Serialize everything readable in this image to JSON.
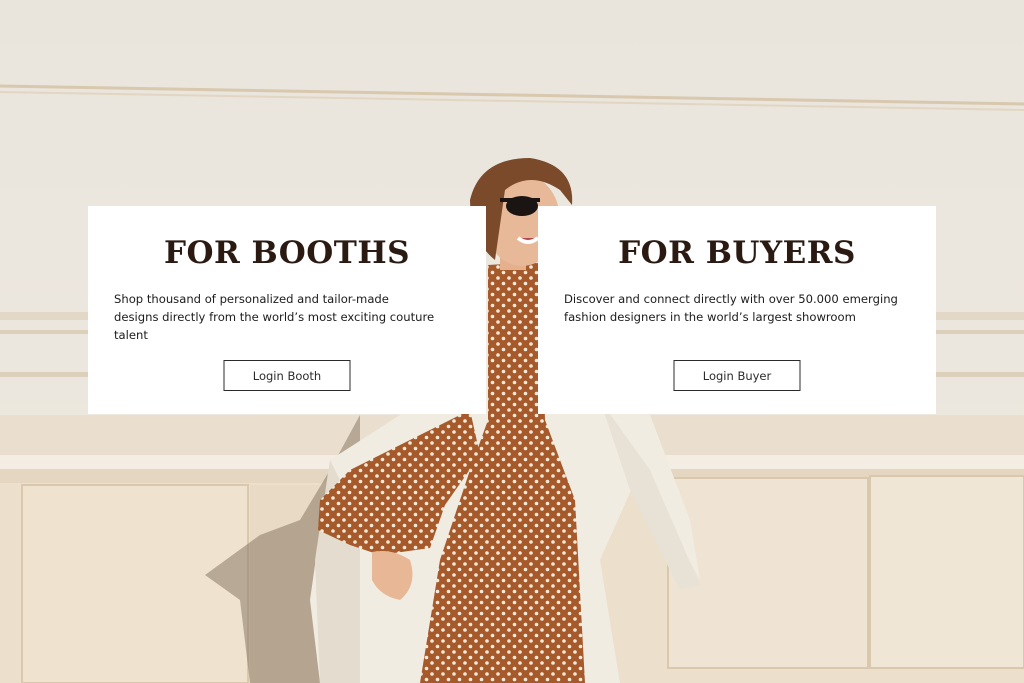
{
  "booths": {
    "title": "FOR BOOTHS",
    "description": "Shop thousand of personalized and tailor-made\ndesigns directly from the world’s most exciting couture talent",
    "button_label": "Login Booth"
  },
  "buyers": {
    "title": "FOR BUYERS",
    "description": "Discover and connect directly with over 50.000 emerging\nfashion designers in the world’s largest showroom",
    "button_label": "Login Buyer"
  },
  "colors": {
    "heading": "#2a1a12",
    "wall": "#ece6dc",
    "dress": "#a4582a",
    "card": "#ffffff"
  }
}
